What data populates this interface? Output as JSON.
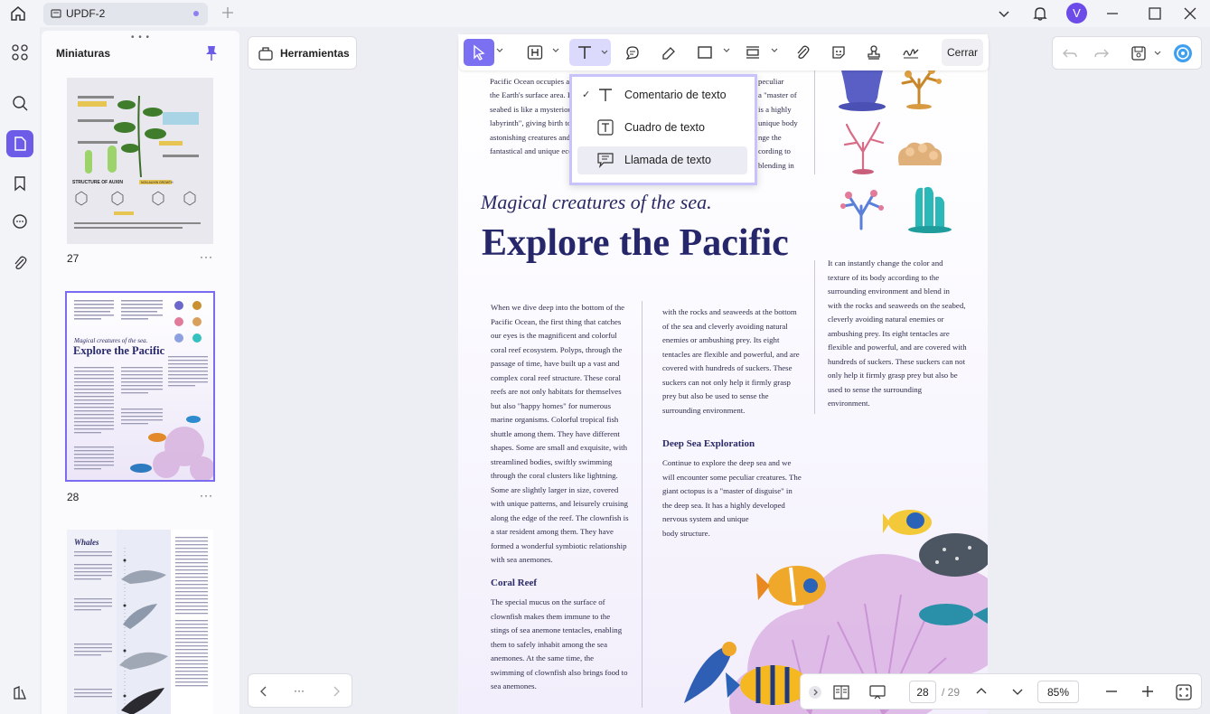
{
  "tab": {
    "label": "UPDF-2"
  },
  "user": {
    "initial": "V"
  },
  "thumbnails": {
    "title": "Miniaturas",
    "pages": [
      {
        "num": "27",
        "more": "···"
      },
      {
        "num": "28",
        "more": "···"
      }
    ],
    "page27_text": {
      "structure": "STRUCTURE OF AUXIN",
      "nonauxin": "NON-AUXIN GROWTH"
    },
    "page29_text": {
      "title": "Whales"
    }
  },
  "tools_button": {
    "label": "Herramientas"
  },
  "toolbar": {
    "close_label": "Cerrar"
  },
  "dropdown": {
    "items": [
      {
        "label": "Comentario de texto",
        "checked": "✓"
      },
      {
        "label": "Cuadro de texto"
      },
      {
        "label": "Llamada de texto"
      }
    ]
  },
  "document": {
    "top_text": "in the vast embrace of blue,\nPacific Ocean occupies about one third\nthe Earth's surface area. Its mysterious\nseabed is like a mysterious world. I\nlabyrinth\", giving birth to countless\nastonishing creatures and wonderful\nfantastical and unique ecosystems.",
    "top_right_text": "into the\npeculiar\na \"master of\nis a highly\nunique body\nnge the\ncording to\nblending in",
    "italic_heading": "Magical creatures of the sea.",
    "title": "Explore the Pacific",
    "right_col_text": "It can instantly change the color and\ntexture of its body according to the\nsurrounding environment and blend in\nwith the rocks and seaweeds on the seabed,\ncleverly avoiding natural enemies or\nambushing prey. Its eight tentacles are\nflexible and powerful, and are covered with\nhundreds of suckers. These suckers can not\nonly help it firmly grasp prey but also be\nused to sense the surrounding\nenvironment.",
    "col1_text": "When we dive deep into the bottom of the\nPacific Ocean, the first thing that catches\nour eyes is the magnificent and colorful\ncoral reef ecosystem. Polyps, through the\npassage of time, have built up a vast and\ncomplex coral reef structure. These coral\nreefs are not only habitats for themselves\nbut also \"happy homes\" for numerous\nmarine organisms. Colorful tropical fish\nshuttle among them. They have different\nshapes. Some are small and exquisite, with\nstreamlined bodies, swiftly swimming\nthrough the coral clusters like lightning.\nSome are slightly larger in size, covered\nwith unique patterns, and leisurely cruising\nalong the edge of the reef. The clownfish is\na star resident among them. They have\nformed a wonderful symbiotic relationship\nwith sea anemones.",
    "coral_reef_heading": "Coral Reef",
    "coral_reef_text": " The special mucus on the surface of\nclownfish makes them immune to the\nstings of sea anemone tentacles, enabling\nthem to safely inhabit among the sea\nanemones. At the same time, the\nswimming of clownfish also brings food to\nsea anemones.",
    "col2_text": "with the rocks and seaweeds at the bottom\nof the sea and cleverly avoiding natural\nenemies or ambushing prey. Its eight\ntentacles are flexible and powerful, and are\ncovered with hundreds of suckers. These\nsuckers can not only help it firmly grasp\nprey but also be used to sense the\nsurrounding environment.",
    "deep_sea_heading": "Deep Sea Exploration",
    "deep_sea_text": "Continue to explore the deep sea and we\nwill encounter some peculiar creatures. The\ngiant octopus is a \"master of disguise\" in\nthe deep sea. It has a highly developed\nnervous system and unique\nbody structure."
  },
  "nav": {
    "more": "···"
  },
  "pager": {
    "current": "28",
    "total": "/ 29"
  },
  "zoom": {
    "value": "85%"
  },
  "colors": {
    "accent": "#6c5ce7",
    "title_navy": "#26266a",
    "coral_pink": "#d9a9de"
  }
}
